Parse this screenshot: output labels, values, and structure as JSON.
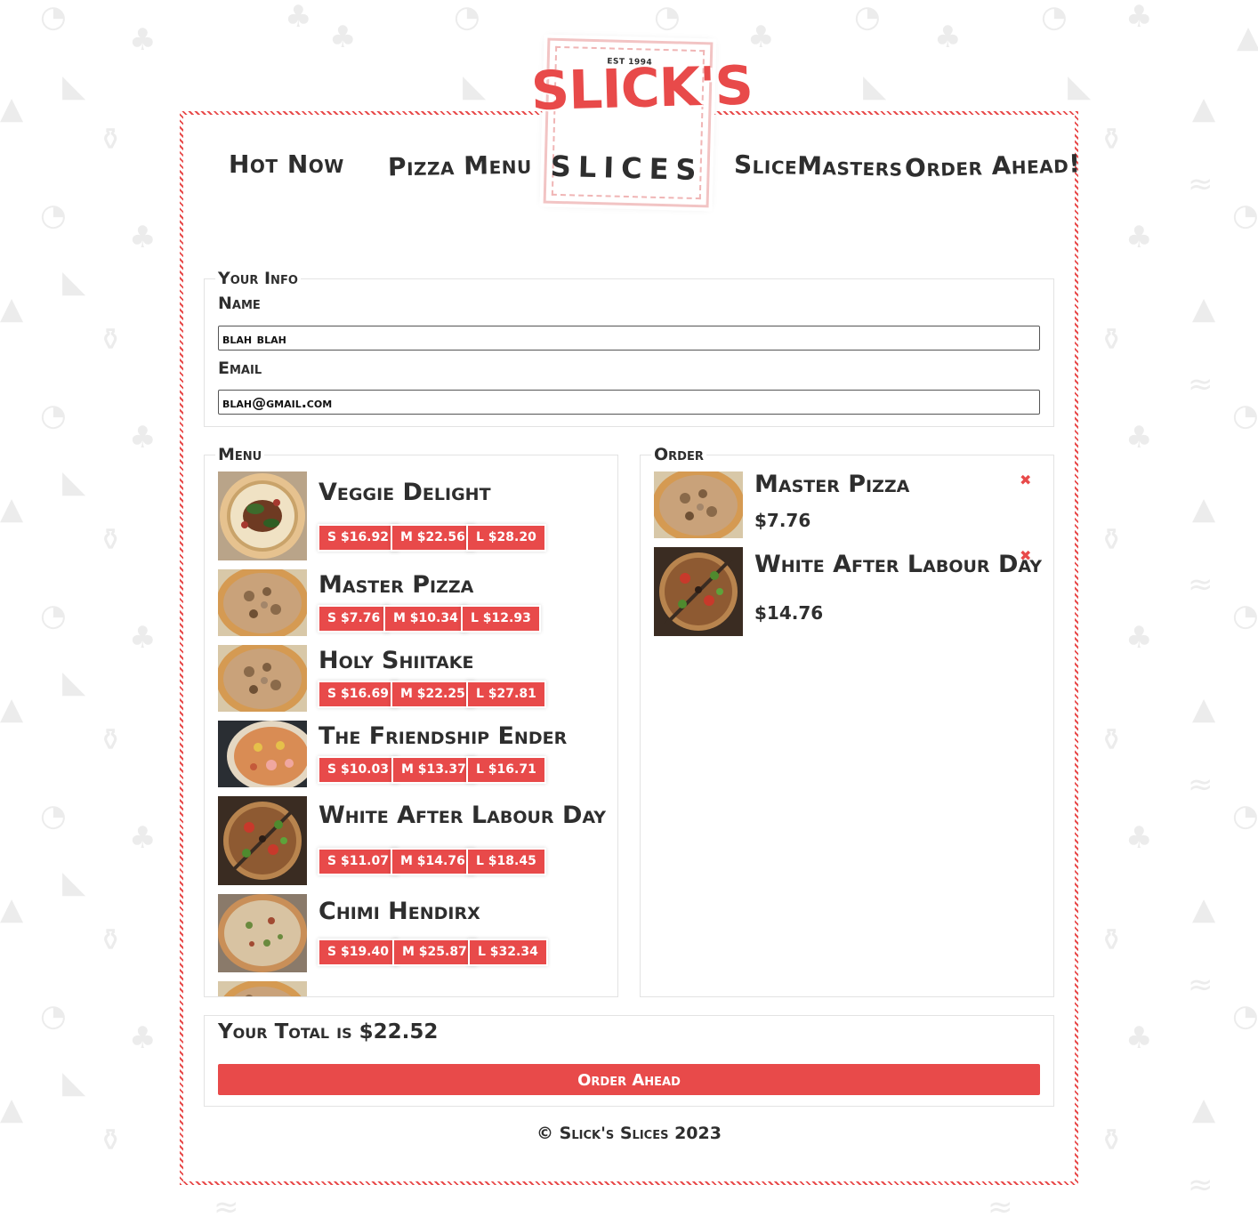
{
  "nav": {
    "hot_now": "Hot Now",
    "pizza_menu": "Pizza Menu",
    "slicemasters": "SliceMasters",
    "order_ahead": "Order Ahead!"
  },
  "logo": {
    "est": "EST 1994",
    "brand": "SLICK'S",
    "sub": "SLICES"
  },
  "info": {
    "legend": "Your Info",
    "name_label": "Name",
    "name_value": "blah blah",
    "email_label": "Email",
    "email_value": "blah@gmail.com"
  },
  "menu": {
    "legend": "Menu",
    "items": [
      {
        "name": "Veggie Delight",
        "prices": [
          "S $16.92",
          "M $22.56",
          "L $28.20"
        ]
      },
      {
        "name": "Master Pizza",
        "prices": [
          "S $7.76",
          "M $10.34",
          "L $12.93"
        ]
      },
      {
        "name": "Holy Shiitake",
        "prices": [
          "S $16.69",
          "M $22.25",
          "L $27.81"
        ]
      },
      {
        "name": "The Friendship Ender",
        "prices": [
          "S $10.03",
          "M $13.37",
          "L $16.71"
        ]
      },
      {
        "name": "White After Labour Day",
        "prices": [
          "S $11.07",
          "M $14.76",
          "L $18.45"
        ]
      },
      {
        "name": "Chimi Hendirx",
        "prices": [
          "S $19.40",
          "M $25.87",
          "L $32.34"
        ]
      }
    ]
  },
  "order": {
    "legend": "Order",
    "items": [
      {
        "name": "Master Pizza",
        "price": "$7.76",
        "remove": "✖"
      },
      {
        "name": "White After Labour Day",
        "price": "$14.76",
        "remove": "✖"
      }
    ]
  },
  "total": {
    "text": "Your Total is $22.52",
    "button": "Order Ahead"
  },
  "footer": "© Slick's Slices 2023",
  "colors": {
    "accent": "#e84a4a",
    "text": "#2e2e2e",
    "border": "#e3e3e3"
  }
}
